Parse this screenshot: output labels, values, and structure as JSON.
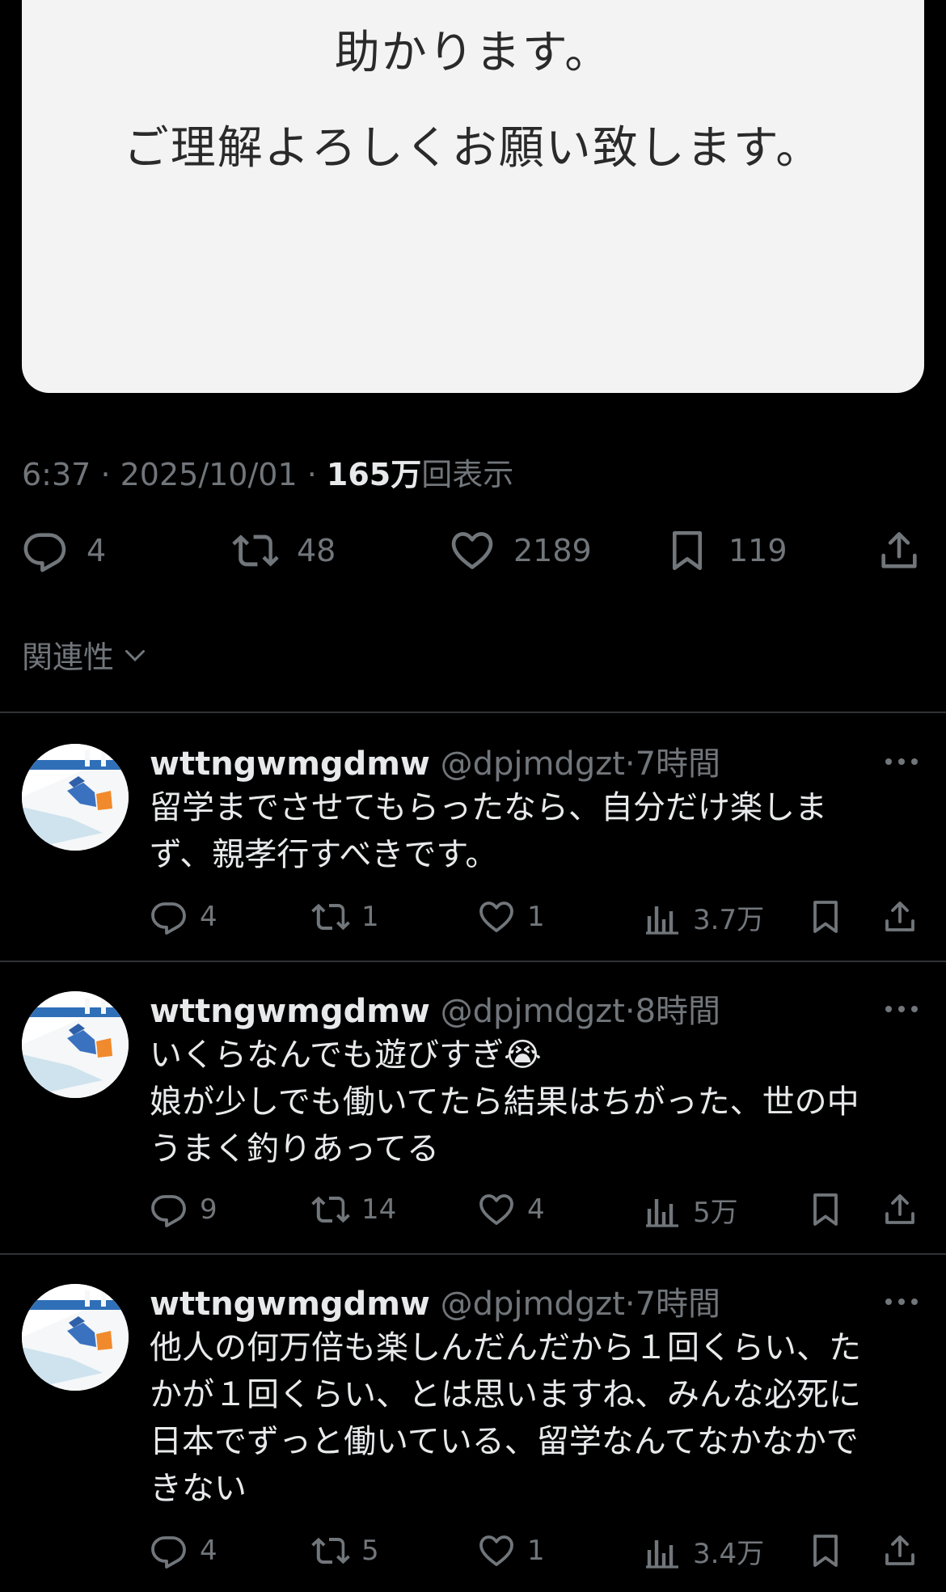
{
  "image_card": {
    "line1": "助かります。",
    "line2": "ご理解よろしくお願い致します。"
  },
  "post": {
    "time": "6:37",
    "date": "2025/10/01",
    "views_number": "165万",
    "views_suffix": "回表示",
    "replies": "4",
    "reposts": "48",
    "likes": "2189",
    "bookmarks": "119"
  },
  "sort_label": "関連性",
  "replies": [
    {
      "name": "wttngwmgdmw",
      "handle": "@dpjmdgzt",
      "time": "7時間",
      "lines": [
        "留学までさせてもらったなら、自分だけ楽しま",
        "ず、親孝行すべきです。"
      ],
      "replies": "4",
      "reposts": "1",
      "likes": "1",
      "views": "3.7万"
    },
    {
      "name": "wttngwmgdmw",
      "handle": "@dpjmdgzt",
      "time": "8時間",
      "lines": [
        "いくらなんでも遊びすぎ😭",
        "娘が少しでも働いてたら結果はちがった、世の中",
        "うまく釣りあってる"
      ],
      "replies": "9",
      "reposts": "14",
      "likes": "4",
      "views": "5万"
    },
    {
      "name": "wttngwmgdmw",
      "handle": "@dpjmdgzt",
      "time": "7時間",
      "lines": [
        "他人の何万倍も楽しんだんだから１回くらい、た",
        "かが１回くらい、とは思いますね、みんな必死に",
        "日本でずっと働いている、留学なんてなかなかで",
        "きない"
      ],
      "replies": "4",
      "reposts": "5",
      "likes": "1",
      "views": "3.4万"
    }
  ],
  "icons": {
    "reply": "reply-icon",
    "repost": "repost-icon",
    "like": "heart-icon",
    "bookmark": "bookmark-icon",
    "share": "share-icon",
    "views": "views-icon",
    "more": "more-icon",
    "chevron": "chevron-down-icon"
  },
  "colors": {
    "background": "#000000",
    "secondary_text": "#71767b",
    "primary_text": "#e7e9ea",
    "divider": "#2f3336"
  }
}
